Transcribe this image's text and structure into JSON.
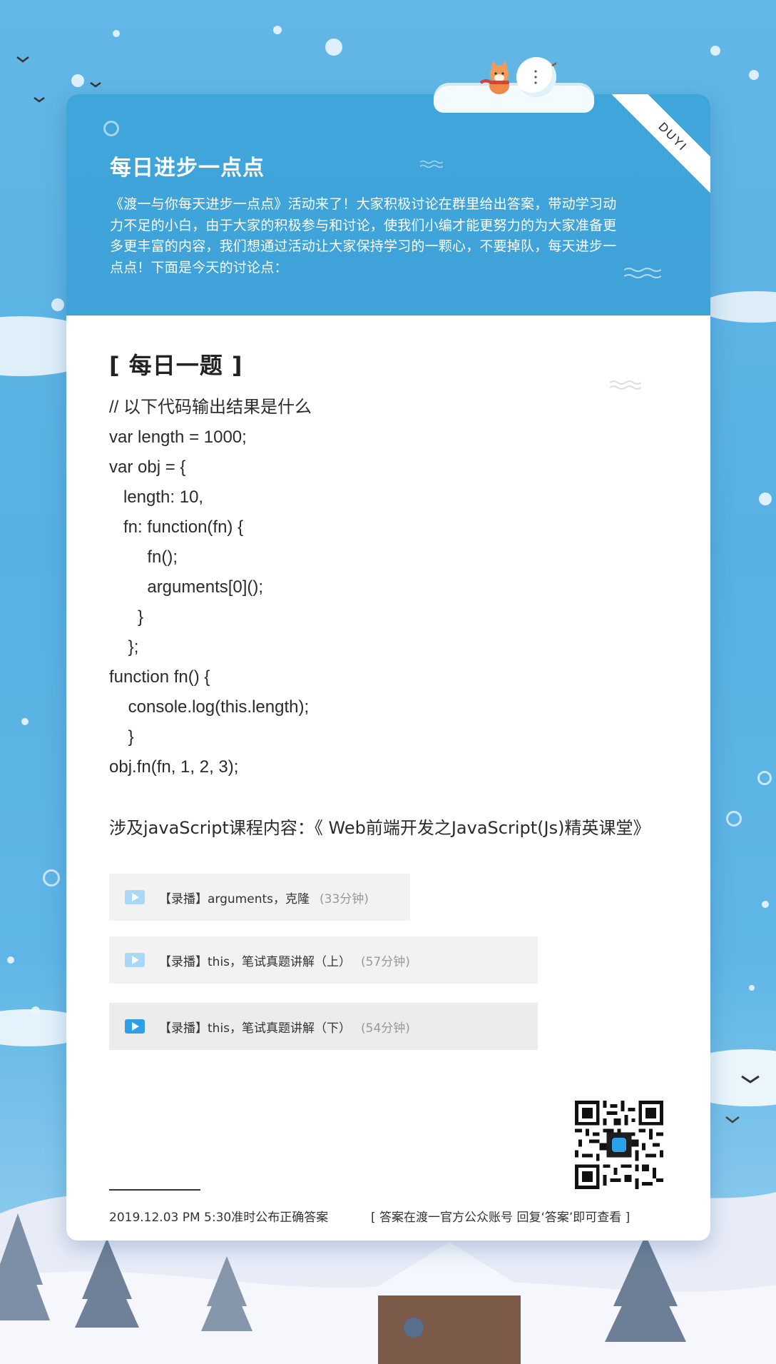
{
  "header": {
    "title": "每日进步一点点",
    "ribbon": "DUYI",
    "description": "《渡一与你每天进步一点点》活动来了！大家积极讨论在群里给出答案，带动学习动力不足的小白，由于大家的积极参与和讨论，使我们小编才能更努力的为大家准备更多更丰富的内容，我们想通过活动让大家保持学习的一颗心，不要掉队，每天进步一点点！下面是今天的讨论点："
  },
  "question": {
    "title": "[ 每日一题 ]",
    "code_lines": [
      "// 以下代码输出结果是什么",
      "var length = 1000;",
      "var obj = {",
      "   length: 10,",
      "   fn: function(fn) {",
      "        fn();",
      "        arguments[0]();",
      "      }",
      "    };",
      "function fn() {",
      "    console.log(this.length);",
      "    }",
      "obj.fn(fn, 1, 2, 3);"
    ]
  },
  "course": {
    "text": "涉及javaScript课程内容：《 Web前端开发之JavaScript(Js)精英课堂》",
    "lessons": [
      {
        "label": "【录播】arguments，克隆",
        "duration": "(33分钟)"
      },
      {
        "label": "【录播】this，笔试真题讲解（上）",
        "duration": "(57分钟)"
      },
      {
        "label": "【录播】this，笔试真题讲解（下）",
        "duration": "(54分钟)"
      }
    ]
  },
  "footer": {
    "left": "2019.12.03  PM  5:30准时公布正确答案",
    "right": "[ 答案在渡一官方公众账号 回复‘答案’即可查看 ]"
  },
  "icons": {
    "play": "play-icon",
    "qr": "qr-code",
    "fox": "fox-mascot",
    "snowman": "snowman"
  },
  "colors": {
    "background": "#5db4e5",
    "header": "#3fa6dc",
    "card": "#ffffff",
    "lesson_bg": "#f2f2f2",
    "play_light": "#a9d7f5",
    "play_active": "#2e9fe6"
  }
}
